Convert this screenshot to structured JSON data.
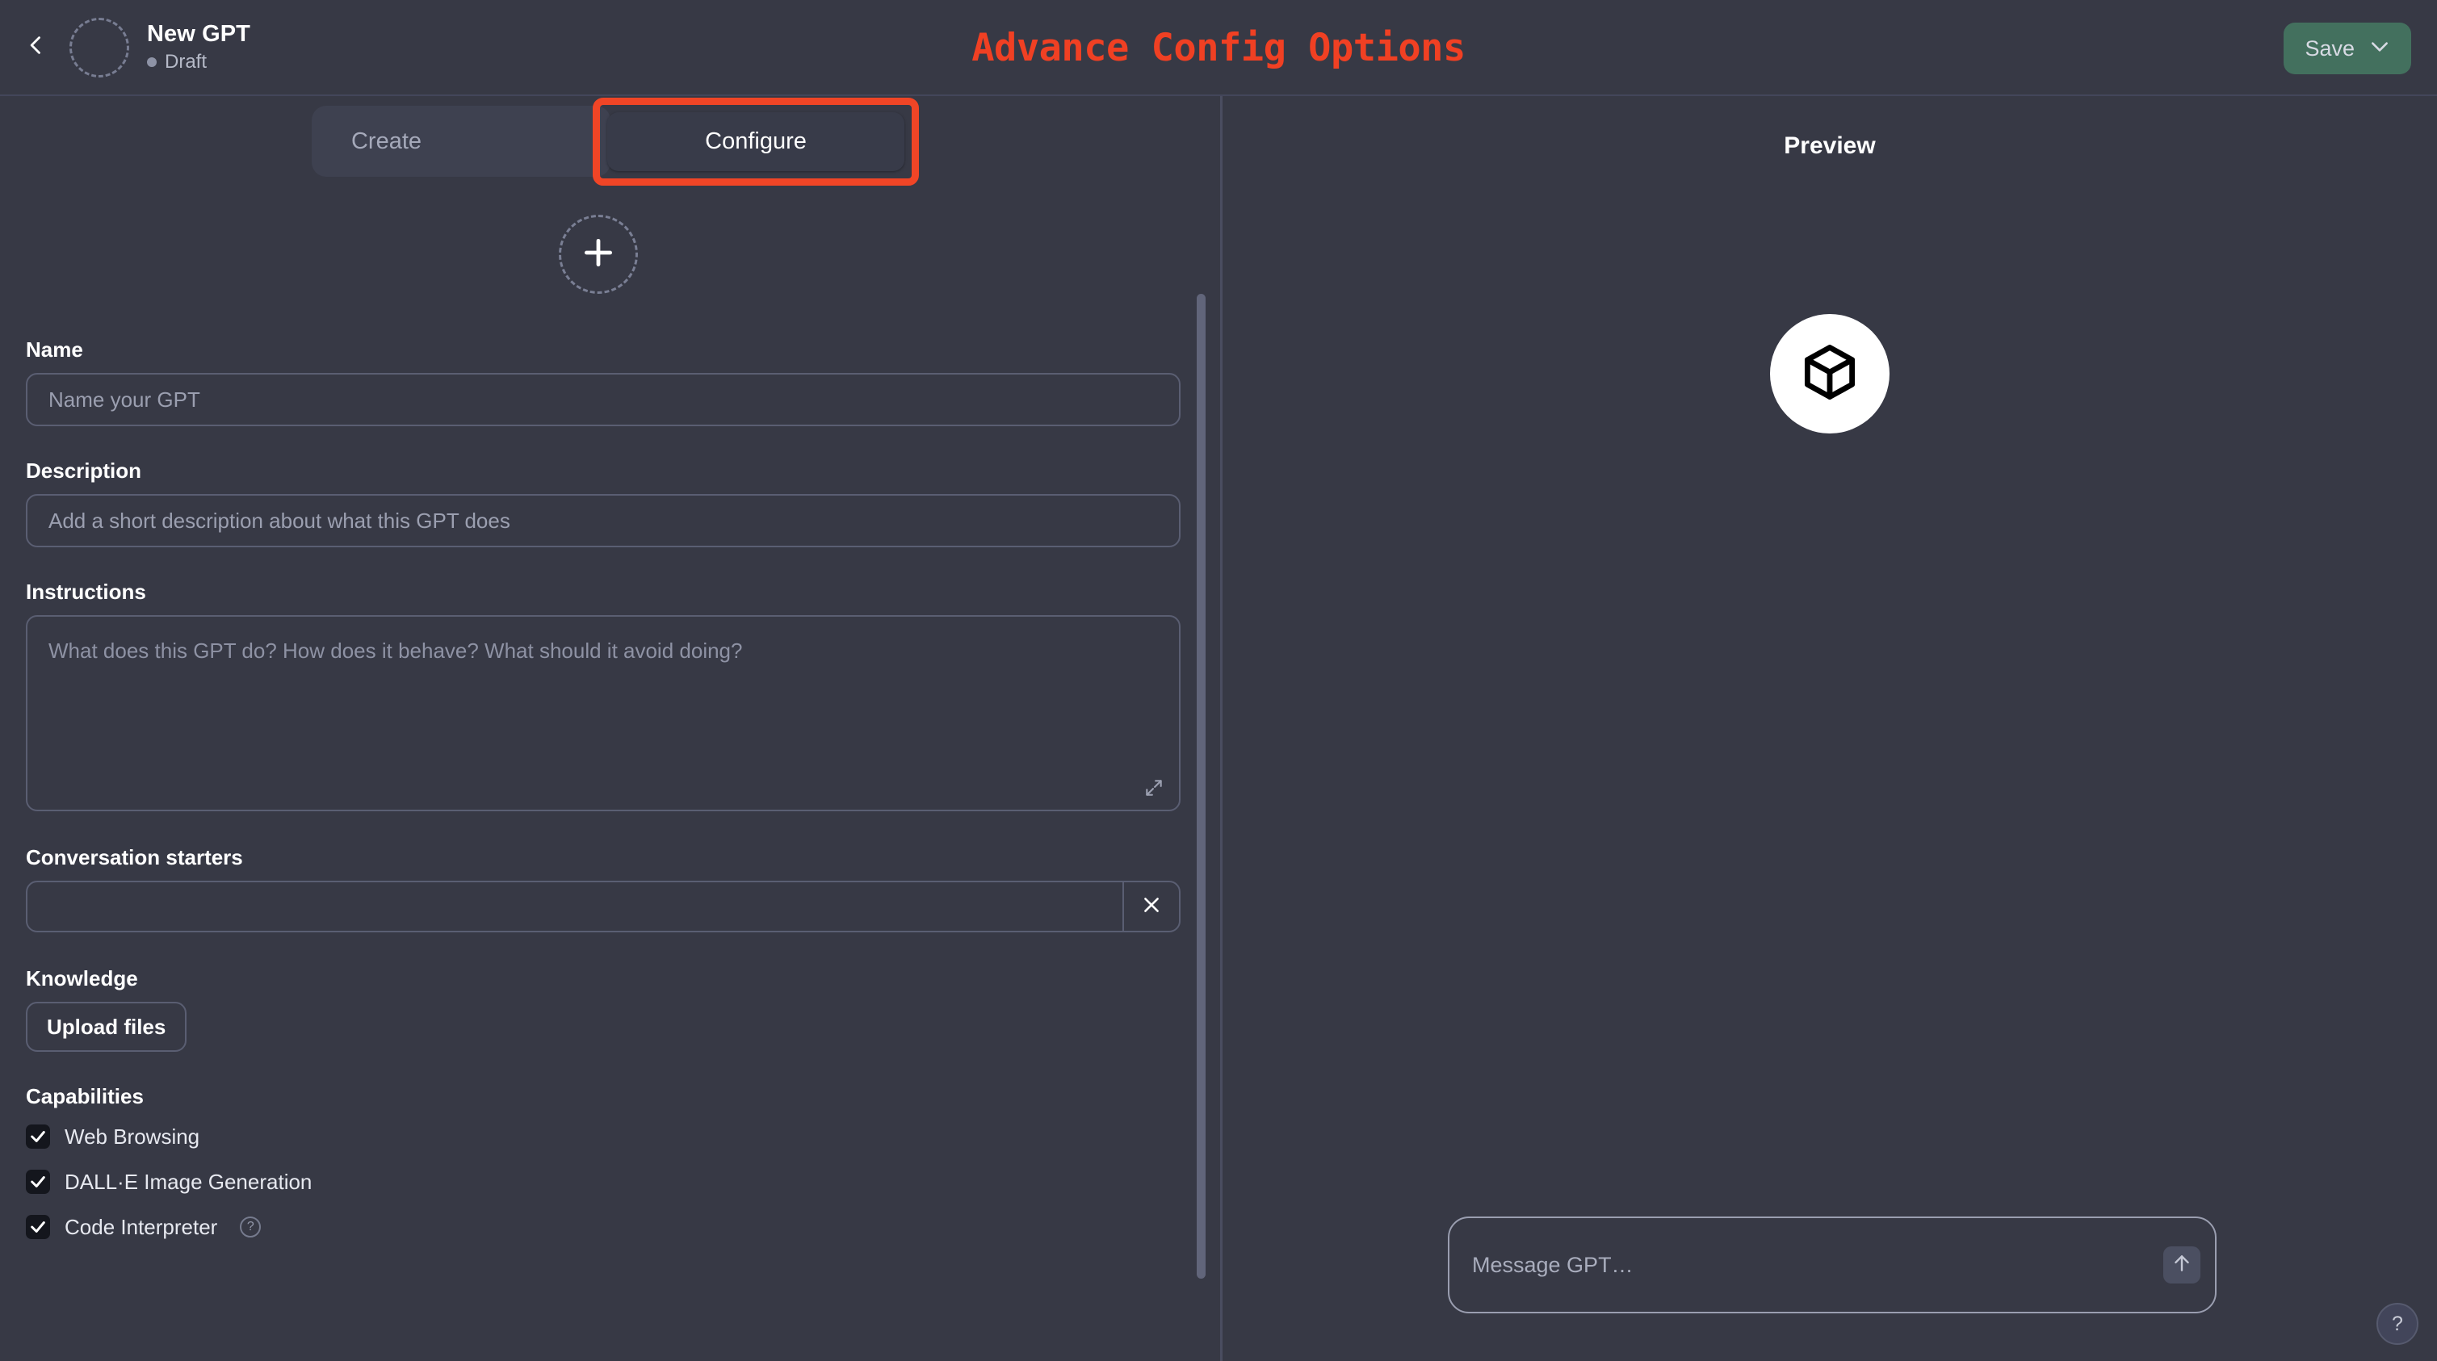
{
  "window": {
    "background_color": "#373945",
    "accent_color": "#f04023",
    "save_button_color": "#43705e"
  },
  "topbar": {
    "back_icon": "chevron-left-icon",
    "avatar_placeholder": "gpt-avatar-placeholder",
    "gpt_title": "New GPT",
    "status_text": "Draft",
    "page_title": "Advance Config Options",
    "save_label": "Save",
    "save_caret_icon": "chevron-down-icon"
  },
  "tabs": [
    {
      "id": "create",
      "label": "Create",
      "selected": false
    },
    {
      "id": "configure",
      "label": "Configure",
      "selected": true,
      "highlighted": true
    }
  ],
  "form": {
    "image_upload": {
      "icon": "plus-icon",
      "label": ""
    },
    "name": {
      "label": "Name",
      "value": "",
      "placeholder": "Name your GPT"
    },
    "description": {
      "label": "Description",
      "value": "",
      "placeholder": "Add a short description about what this GPT does"
    },
    "instructions": {
      "label": "Instructions",
      "value": "",
      "placeholder": "What does this GPT do? How does it behave? What should it avoid doing?",
      "expand_icon": "expand-diagonal-icon"
    },
    "conversation_starters": {
      "label": "Conversation starters",
      "items": [
        {
          "value": "",
          "placeholder": "",
          "remove_icon": "close-icon"
        }
      ]
    },
    "knowledge": {
      "label": "Knowledge",
      "upload_label": "Upload files"
    },
    "capabilities": {
      "label": "Capabilities",
      "items": [
        {
          "label": "Web Browsing",
          "checked": true,
          "help": false
        },
        {
          "label": "DALL·E Image Generation",
          "checked": true,
          "help": false
        },
        {
          "label": "Code Interpreter",
          "checked": true,
          "help": true,
          "help_glyph": "?"
        }
      ]
    }
  },
  "preview": {
    "title": "Preview",
    "logo_icon": "cube-icon",
    "message_input": {
      "value": "",
      "placeholder": "Message GPT…"
    },
    "send_icon": "arrow-up-icon",
    "help_glyph": "?"
  }
}
